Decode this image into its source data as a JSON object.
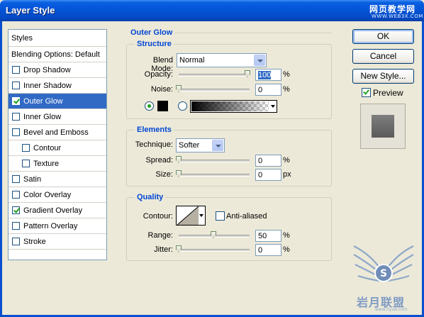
{
  "window": {
    "title": "Layer Style",
    "watermark_cn": "网页教学网",
    "watermark_url": "WWW.WEB3X.COM"
  },
  "styles_list": {
    "header": "Styles",
    "blending": "Blending Options: Default",
    "items": [
      {
        "label": "Drop Shadow",
        "checked": false,
        "indent": false,
        "selected": false
      },
      {
        "label": "Inner Shadow",
        "checked": false,
        "indent": false,
        "selected": false
      },
      {
        "label": "Outer Glow",
        "checked": true,
        "indent": false,
        "selected": true
      },
      {
        "label": "Inner Glow",
        "checked": false,
        "indent": false,
        "selected": false
      },
      {
        "label": "Bevel and Emboss",
        "checked": false,
        "indent": false,
        "selected": false
      },
      {
        "label": "Contour",
        "checked": false,
        "indent": true,
        "selected": false
      },
      {
        "label": "Texture",
        "checked": false,
        "indent": true,
        "selected": false
      },
      {
        "label": "Satin",
        "checked": false,
        "indent": false,
        "selected": false
      },
      {
        "label": "Color Overlay",
        "checked": false,
        "indent": false,
        "selected": false
      },
      {
        "label": "Gradient Overlay",
        "checked": true,
        "indent": false,
        "selected": false
      },
      {
        "label": "Pattern Overlay",
        "checked": false,
        "indent": false,
        "selected": false
      },
      {
        "label": "Stroke",
        "checked": false,
        "indent": false,
        "selected": false
      }
    ]
  },
  "outer_glow": {
    "title": "Outer Glow",
    "structure": {
      "title": "Structure",
      "blend_mode_label": "Blend Mode:",
      "blend_mode_value": "Normal",
      "opacity_label": "Opacity:",
      "opacity_value": "100",
      "opacity_unit": "%",
      "noise_label": "Noise:",
      "noise_value": "0",
      "noise_unit": "%",
      "glow_color": "#000000"
    },
    "elements": {
      "title": "Elements",
      "technique_label": "Technique:",
      "technique_value": "Softer",
      "spread_label": "Spread:",
      "spread_value": "0",
      "spread_unit": "%",
      "size_label": "Size:",
      "size_value": "0",
      "size_unit": "px"
    },
    "quality": {
      "title": "Quality",
      "contour_label": "Contour:",
      "anti_aliased_label": "Anti-aliased",
      "range_label": "Range:",
      "range_value": "50",
      "range_unit": "%",
      "jitter_label": "Jitter:",
      "jitter_value": "0",
      "jitter_unit": "%"
    }
  },
  "buttons": {
    "ok": "OK",
    "cancel": "Cancel",
    "new_style": "New Style...",
    "preview": "Preview"
  },
  "watermark_logo": {
    "text_cn": "岩月联盟",
    "url": "www.5yue.com"
  },
  "colors": {
    "accent": "#316AC5",
    "group_title": "#0046D5",
    "titlebar": "#0454D8"
  }
}
